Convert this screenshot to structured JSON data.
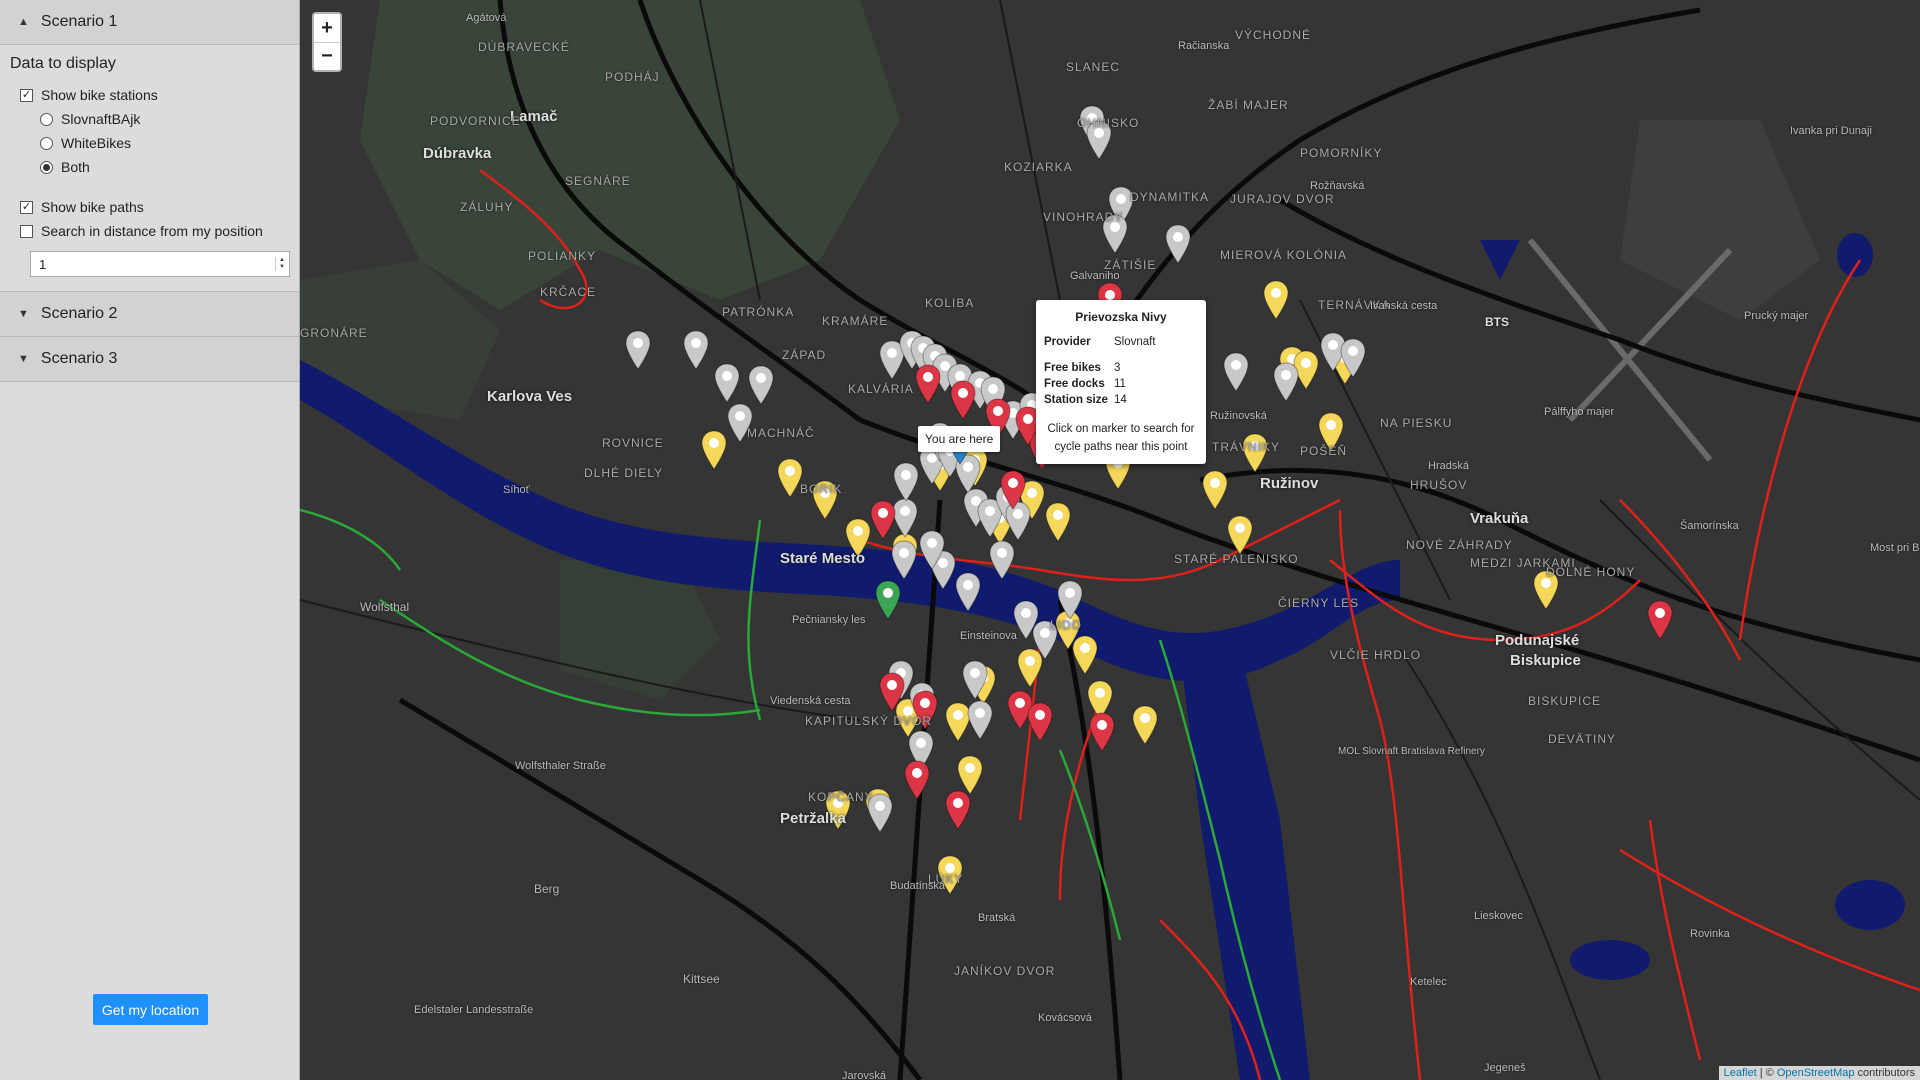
{
  "sidebar": {
    "scenario1": {
      "label": "Scenario 1",
      "caret": "▲"
    },
    "data_title": "Data to display",
    "show_stations": {
      "label": "Show bike stations",
      "checked": true
    },
    "providers": [
      {
        "label": "SlovnaftBAjk",
        "selected": false
      },
      {
        "label": "WhiteBikes",
        "selected": false
      },
      {
        "label": "Both",
        "selected": true
      }
    ],
    "show_paths": {
      "label": "Show bike paths",
      "checked": true
    },
    "search_distance": {
      "label": "Search in distance from my position",
      "checked": false
    },
    "distance_value": "1",
    "scenario2": {
      "label": "Scenario 2",
      "caret": "▼"
    },
    "scenario3": {
      "label": "Scenario 3",
      "caret": "▼"
    },
    "location_button": "Get my location"
  },
  "map": {
    "zoom_in": "+",
    "zoom_out": "−",
    "places": [
      "Lamač",
      "Dúbravka",
      "Karlova Ves",
      "Staré Mesto",
      "Ružinov",
      "Vrakuňa",
      "Podunajské",
      "Biskupice",
      "Petržalka",
      "BTS"
    ],
    "districts": [
      "DÚBRAVECKÉ",
      "PODHÁJ",
      "PODVORNICE",
      "ZÁLUHY",
      "SEGNÁRE",
      "POLIANKY",
      "KRČACE",
      "GRONÁRE",
      "PATRÓNKA",
      "ZÁPAD",
      "KRAMÁRE",
      "KOLIBA",
      "KALVÁRIA",
      "MACHNÁČ",
      "SLANEC",
      "VÝCHODNÉ",
      "ŽABÍ MAJER",
      "OHNISKO",
      "KOZIARKA",
      "DYNAMITKA",
      "JURAJOV DVOR",
      "POMORNÍKY",
      "VINOHRADY",
      "ZÁTIŠIE",
      "MIEROVÁ KOLÓNIA",
      "TERNÁVKA",
      "TRÁVNIKY",
      "POŠEŇ",
      "NA PIESKU",
      "HRUŠOV",
      "ČIERNY LES",
      "NOVÉ ZÁHRADY",
      "MEDZI JARKAMI",
      "DOLNÉ HONY",
      "BISKUPICE",
      "DEVÄTINY",
      "VLČIE HRDLO",
      "KAPITULSKÝ DVOR",
      "KOPČANY",
      "LÚKY",
      "JANÍKOV DVOR",
      "STARÉ PALENISKO",
      "LIDO",
      "ROVNICE",
      "DLHÉ DIELY",
      "BORIK"
    ],
    "minor_labels": [
      "Agátová",
      "Síhoť",
      "Wolfsthal",
      "Pečniansky les",
      "Einsteinova",
      "Viedenská cesta",
      "Wolfsthaler Straße",
      "Berg",
      "Kittsee",
      "Edelstaler Landesstraße",
      "Jarovská",
      "Jegeneš",
      "Ketelec",
      "Lieskovec",
      "Rovinka",
      "Most pri Bratislave",
      "Ivanka pri Dunaji",
      "Prucký majer",
      "Pálffyho majer",
      "MOL Slovnaft Bratislava Refinery",
      "Ivanská cesta",
      "Rožňavská",
      "Ružinovská",
      "Budatínska",
      "Bratská",
      "Kovácsová",
      "Hradská",
      "Račianska",
      "Šamorínska",
      "Galvaniho"
    ],
    "popup": {
      "title": "Prievozska Nivy",
      "provider_label": "Provider",
      "provider_value": "Slovnaft",
      "bikes_label": "Free bikes",
      "bikes_value": "3",
      "docks_label": "Free docks",
      "docks_value": "11",
      "size_label": "Station size",
      "size_value": "14",
      "note": "Click on marker to search for cycle paths near this point"
    },
    "tooltip": "You are here",
    "attribution": {
      "leaflet": "Leaflet",
      "sep": " | © ",
      "osm": "OpenStreetMap",
      "rest": " contributors"
    },
    "marker_colors": {
      "slovnaft": "#f5d75a",
      "whitebikes": "#c8c8c8",
      "selected": "#dc3545",
      "position": "#2a82cb",
      "green": "#3aa655"
    },
    "marker_counts": {
      "yellow": 26,
      "gray": 42,
      "red": 20,
      "blue": 1,
      "green": 1
    }
  }
}
